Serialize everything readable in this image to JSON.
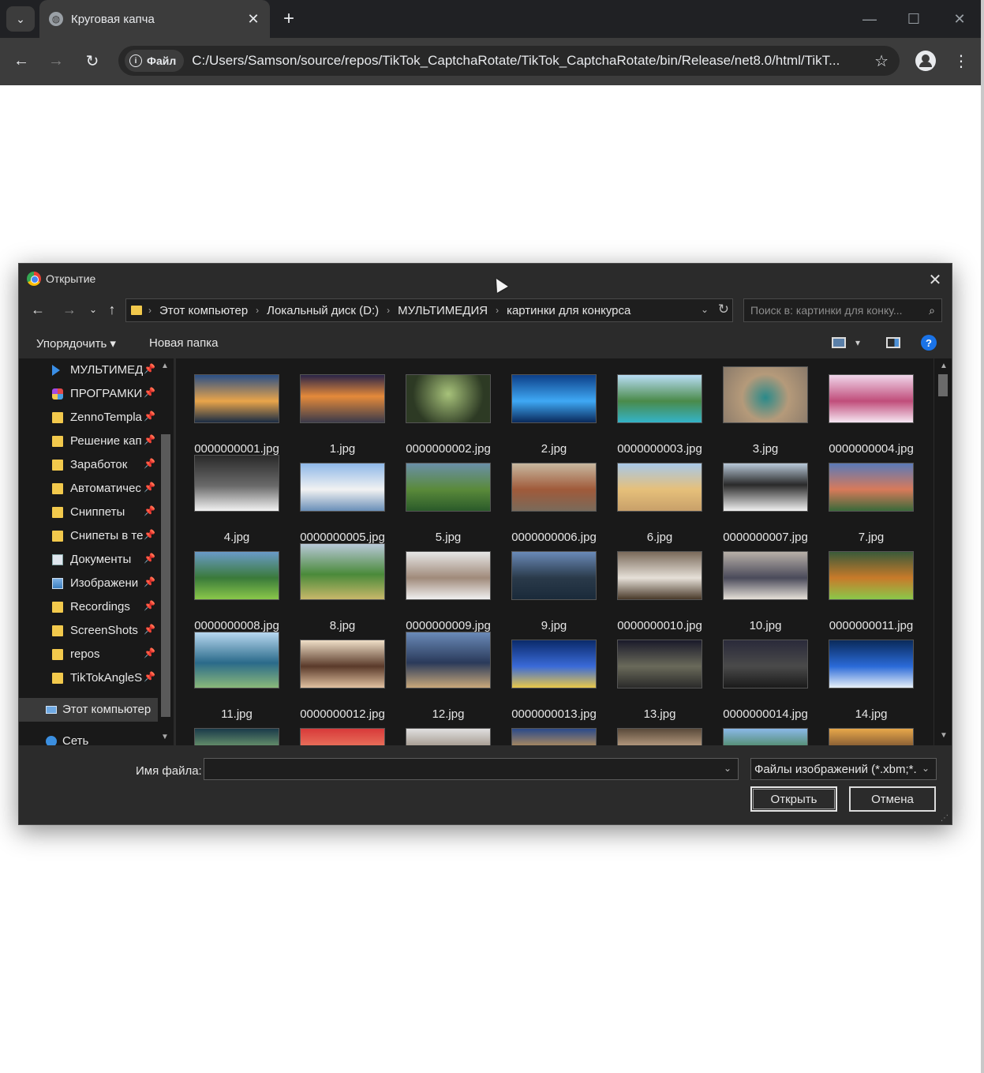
{
  "browser": {
    "tab_title": "Круговая капча",
    "tab_close": "✕",
    "new_tab": "+",
    "site_chip_label": "Файл",
    "url": "C:/Users/Samson/source/repos/TikTok_CaptchaRotate/TikTok_CaptchaRotate/bin/Release/net8.0/html/TikT...",
    "window_controls": {
      "minimize": "—",
      "maximize": "☐",
      "close": "✕"
    }
  },
  "dialog": {
    "title": "Открытие",
    "breadcrumbs": [
      "Этот компьютер",
      "Локальный диск (D:)",
      "МУЛЬТИМЕДИЯ",
      "картинки для конкурса"
    ],
    "search_placeholder": "Поиск в: картинки для конку...",
    "organize_label": "Упорядочить ▾",
    "new_folder_label": "Новая папка",
    "help_label": "?",
    "nav_items": [
      {
        "label": "МУЛЬТИМЕД",
        "icon": "triangle-icon",
        "pinned": true
      },
      {
        "label": "ПРОГРАМКИ",
        "icon": "app-icon",
        "pinned": true
      },
      {
        "label": "ZennoTempla",
        "icon": "folder-icon",
        "pinned": true
      },
      {
        "label": "Решение кап",
        "icon": "folder-icon",
        "pinned": true
      },
      {
        "label": "Заработок",
        "icon": "folder-icon",
        "pinned": true
      },
      {
        "label": "Автоматичес",
        "icon": "folder-icon",
        "pinned": true
      },
      {
        "label": "Сниппеты",
        "icon": "folder-icon",
        "pinned": true
      },
      {
        "label": "Снипеты в те",
        "icon": "folder-icon",
        "pinned": true
      },
      {
        "label": "Документы",
        "icon": "document-icon",
        "pinned": true
      },
      {
        "label": "Изображени",
        "icon": "image-icon",
        "pinned": true
      },
      {
        "label": "Recordings",
        "icon": "folder-icon",
        "pinned": true
      },
      {
        "label": "ScreenShots",
        "icon": "folder-icon",
        "pinned": true
      },
      {
        "label": "repos",
        "icon": "folder-icon",
        "pinned": true
      },
      {
        "label": "TikTokAngleS",
        "icon": "folder-icon",
        "pinned": true
      },
      {
        "label": "Этот компьютер",
        "icon": "computer-icon",
        "pinned": false
      },
      {
        "label": "Сеть",
        "icon": "network-icon",
        "pinned": false
      }
    ],
    "files": [
      "0000000001.jpg",
      "1.jpg",
      "0000000002.jpg",
      "2.jpg",
      "0000000003.jpg",
      "3.jpg",
      "0000000004.jpg",
      "4.jpg",
      "0000000005.jpg",
      "5.jpg",
      "0000000006.jpg",
      "6.jpg",
      "0000000007.jpg",
      "7.jpg",
      "0000000008.jpg",
      "8.jpg",
      "0000000009.jpg",
      "9.jpg",
      "0000000010.jpg",
      "10.jpg",
      "0000000011.jpg",
      "11.jpg",
      "0000000012.jpg",
      "12.jpg",
      "0000000013.jpg",
      "13.jpg",
      "0000000014.jpg",
      "14.jpg",
      "",
      "",
      "",
      "",
      "",
      "",
      ""
    ],
    "filename_label": "Имя файла:",
    "filename_value": "",
    "filter_label": "Файлы изображений (*.xbm;*.",
    "open_button": "Открыть",
    "cancel_button": "Отмена"
  },
  "colors": {
    "chrome_dark": "#202124",
    "chrome_toolbar": "#3c3c3c",
    "dialog_bg": "#2b2b2b",
    "pane_bg": "#191919",
    "accent": "#1a73e8",
    "folder": "#f2c94c"
  }
}
